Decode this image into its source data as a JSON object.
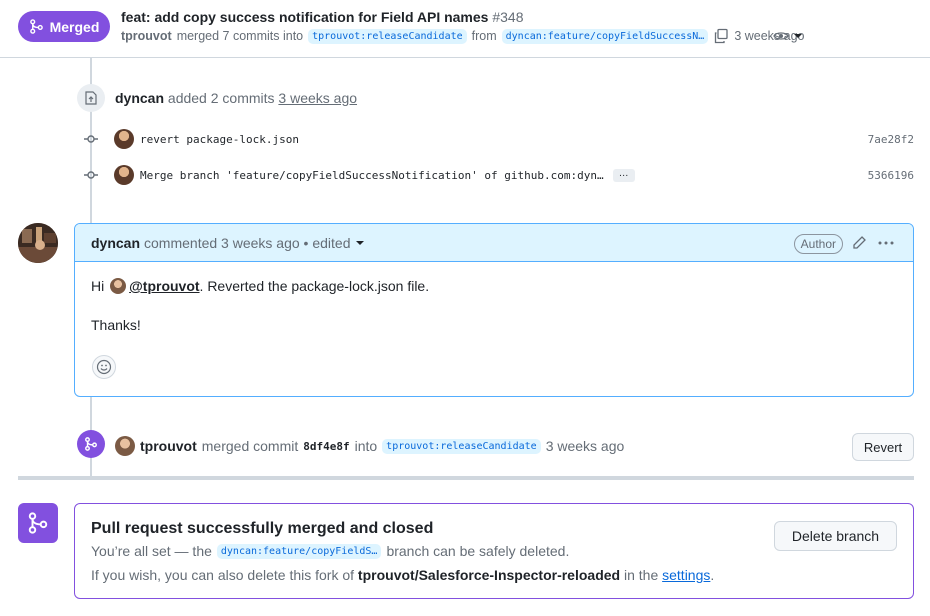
{
  "header": {
    "status_label": "Merged",
    "title": "feat: add copy success notification for Field API names",
    "number": "#348",
    "author": "tprouvot",
    "merged_text": "merged 7 commits into",
    "base_branch": "tprouvot:releaseCandidate",
    "from_text": "from",
    "head_branch": "dyncan:feature/copyFieldSuccessN…",
    "time": "3 weeks ago"
  },
  "commits_event": {
    "user": "dyncan",
    "action": "added 2 commits",
    "time": "3 weeks ago",
    "commits": [
      {
        "message": "revert package-lock.json",
        "sha": "7ae28f2"
      },
      {
        "message": "Merge branch 'feature/copyFieldSuccessNotification' of github.com:dyn…",
        "sha": "5366196",
        "more": "…"
      }
    ]
  },
  "comment": {
    "user": "dyncan",
    "meta": "commented 3 weeks ago • edited",
    "author_badge": "Author",
    "greeting": "Hi",
    "mention": "@tprouvot",
    "text1_rest": ". Reverted the package-lock.json file.",
    "text2": "Thanks!"
  },
  "merge_event": {
    "user": "tprouvot",
    "action": "merged commit",
    "sha": "8df4e8f",
    "into": "into",
    "branch": "tprouvot:releaseCandidate",
    "time": "3 weeks ago",
    "revert_label": "Revert"
  },
  "merged_box": {
    "title": "Pull request successfully merged and closed",
    "line1_pre": "You’re all set — the",
    "branch": "dyncan:feature/copyFieldS…",
    "line1_post": "branch can be safely deleted.",
    "line2_pre": "If you wish, you can also delete this fork of",
    "repo": "tprouvot/Salesforce-Inspector-reloaded",
    "line2_mid": "in the",
    "settings_link": "settings",
    "line2_end": ".",
    "delete_label": "Delete branch"
  },
  "colors": {
    "merged_purple": "#8250df",
    "link_blue": "#0969da",
    "comment_border": "#54aeff",
    "comment_header_bg": "#ddf4ff"
  },
  "icons": [
    "git-merge-icon",
    "copy-icon",
    "eye-icon",
    "push-icon",
    "git-commit-icon",
    "pencil-icon",
    "kebab-icon",
    "smiley-icon"
  ]
}
